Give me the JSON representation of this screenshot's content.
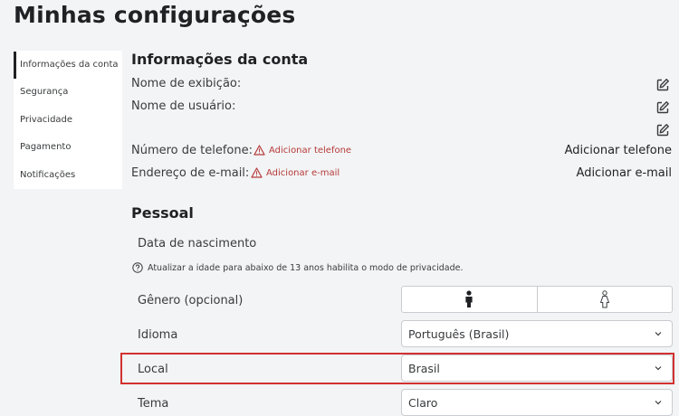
{
  "page_title": "Minhas configurações",
  "sidebar": {
    "items": [
      {
        "label": "Informações da conta"
      },
      {
        "label": "Segurança"
      },
      {
        "label": "Privacidade"
      },
      {
        "label": "Pagamento"
      },
      {
        "label": "Notificações"
      }
    ]
  },
  "account": {
    "title": "Informações da conta",
    "display_name_label": "Nome de exibição:",
    "username_label": "Nome de usuário:",
    "phone_label": "Número de telefone:",
    "phone_warning": "Adicionar telefone",
    "phone_action": "Adicionar telefone",
    "email_label": "Endereço de e-mail:",
    "email_warning": "Adicionar e-mail",
    "email_action": "Adicionar e-mail"
  },
  "personal": {
    "title": "Pessoal",
    "birthdate_label": "Data de nascimento",
    "age_hint": "Atualizar a idade para abaixo de 13 anos habilita o modo de privacidade.",
    "gender_label": "Gênero (opcional)",
    "language_label": "Idioma",
    "language_value": "Português (Brasil)",
    "location_label": "Local",
    "location_value": "Brasil",
    "theme_label": "Tema",
    "theme_value": "Claro"
  },
  "colors": {
    "highlight": "#d23131",
    "warning": "#b83a3a"
  }
}
